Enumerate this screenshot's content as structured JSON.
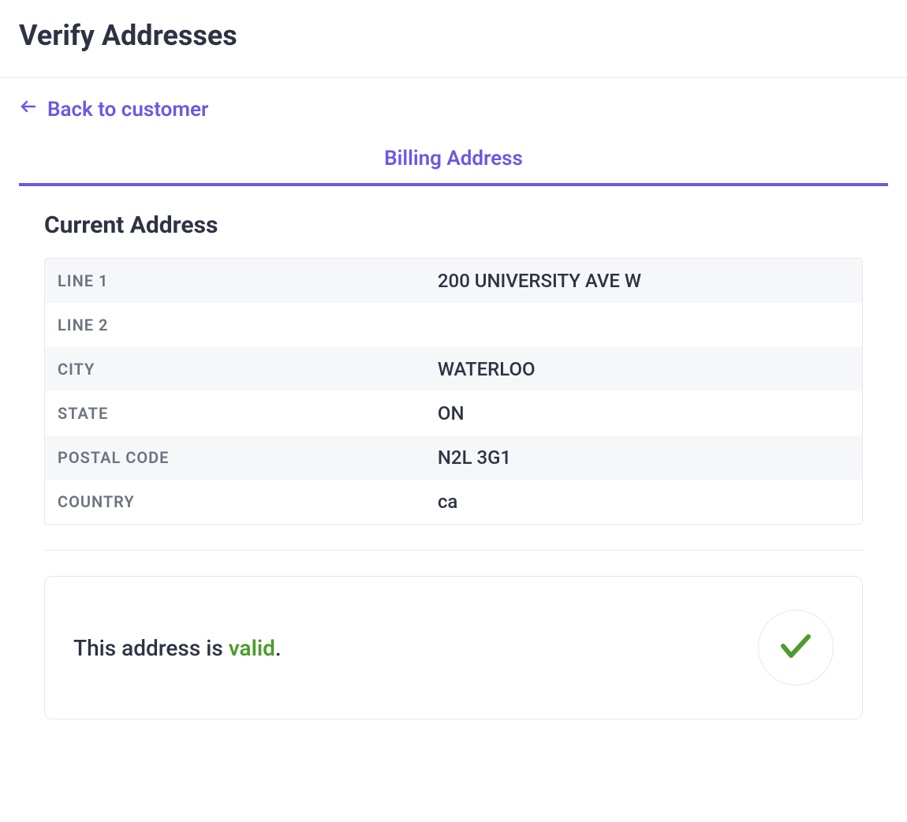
{
  "header": {
    "title": "Verify Addresses"
  },
  "back_link": {
    "label": "Back to customer"
  },
  "tabs": [
    {
      "label": "Billing Address"
    }
  ],
  "current_address": {
    "title": "Current Address",
    "fields": {
      "line1": {
        "label": "LINE 1",
        "value": "200 UNIVERSITY AVE W"
      },
      "line2": {
        "label": "LINE 2",
        "value": ""
      },
      "city": {
        "label": "CITY",
        "value": "WATERLOO"
      },
      "state": {
        "label": "STATE",
        "value": "ON"
      },
      "postal_code": {
        "label": "POSTAL CODE",
        "value": "N2L 3G1"
      },
      "country": {
        "label": "COUNTRY",
        "value": "ca"
      }
    }
  },
  "status": {
    "prefix": "This address is ",
    "word": "valid",
    "suffix": ".",
    "valid": true
  },
  "colors": {
    "accent": "#6a58e6",
    "success": "#4f9b2e",
    "text": "#2d3344",
    "muted": "#6b7280",
    "border": "#e5e7eb"
  }
}
